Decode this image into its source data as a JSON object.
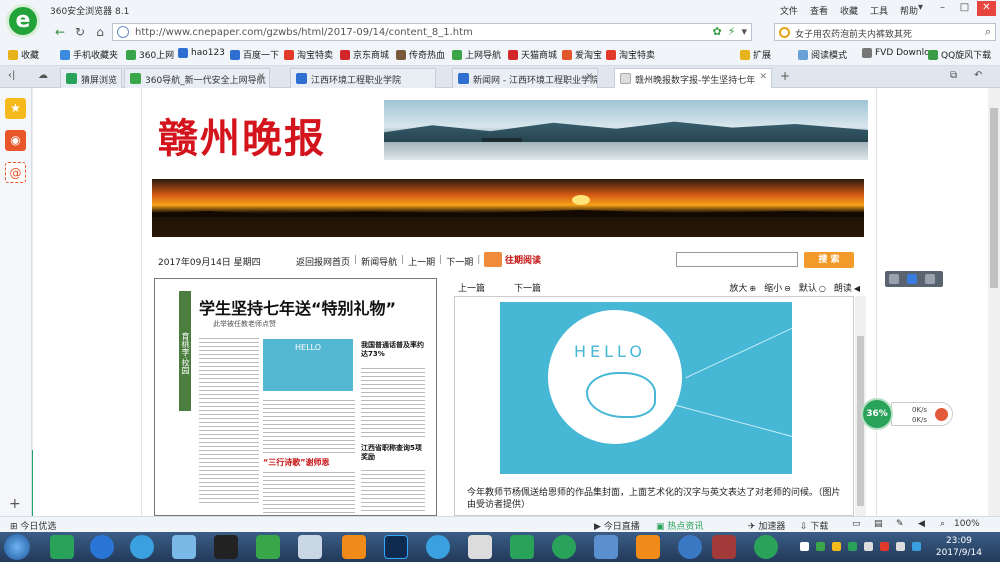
{
  "browser": {
    "title": "360安全浏览器 8.1",
    "menu": [
      "文件",
      "查看",
      "收藏",
      "工具",
      "帮助"
    ],
    "url": "http://www.cnepaper.com/gzwbs/html/2017-09/14/content_8_1.htm",
    "search_text": "女子用农药泡前夫内裤致其死",
    "logo_letter": "e"
  },
  "favorites": [
    {
      "label": "收藏",
      "color": "#e8b21a"
    },
    {
      "label": "手机收藏夹",
      "color": "#3a8be0"
    },
    {
      "label": "360上网",
      "color": "#3aa64a"
    },
    {
      "label": "hao123",
      "color": "#2f6fd1"
    },
    {
      "label": "百度一下",
      "color": "#2f6fd1"
    },
    {
      "label": "淘宝特卖",
      "color": "#e23a2a"
    },
    {
      "label": "京东商城",
      "color": "#d3262a"
    },
    {
      "label": "传奇热血",
      "color": "#7a5a3a"
    },
    {
      "label": "上网导航",
      "color": "#3aa64a"
    },
    {
      "label": "天猫商城",
      "color": "#d3262a"
    },
    {
      "label": "爱淘宝",
      "color": "#e2562a"
    },
    {
      "label": "淘宝特卖",
      "color": "#e23a2a"
    },
    {
      "label": "扩展",
      "color": "#e8b21a"
    },
    {
      "label": "阅读模式",
      "color": "#6aa0d8"
    },
    {
      "label": "FVD Downloa",
      "color": "#777777"
    },
    {
      "label": "QQ旋风下载",
      "color": "#3a9b46"
    }
  ],
  "tabs": [
    {
      "label": "猜屏浏览",
      "color": "#2aa35a"
    },
    {
      "label": "360导航_新一代安全上网导航",
      "color": "#3aa64a"
    },
    {
      "label": "江西环境工程职业学院",
      "color": "#2f6fd1"
    },
    {
      "label": "新闻网 - 江西环境工程职业学院",
      "color": "#2f6fd1"
    },
    {
      "label": "赣州晚报数字报-学生坚持七年",
      "color": "#dddddd"
    }
  ],
  "page": {
    "masthead": "赣州晚报",
    "date": "2017年09月14日  星期四",
    "nav_links": [
      "返回报网首页",
      "新闻导航",
      "上一期",
      "下一期"
    ],
    "past_issue": "往期阅读",
    "search_button": "搜 索"
  },
  "newspaper": {
    "headline": "学生坚持七年送“特别礼物”",
    "subhead": "此举被任教老师点赞",
    "column": "育桃李·校园",
    "hello": "HELLO",
    "side_story1": "我国普通话普及率约达73%",
    "poem": "“三行诗歌”谢师恩",
    "side_story2": "江西省职称查询5项奖励"
  },
  "article": {
    "prev": "上一篇",
    "next": "下一篇",
    "tools": [
      "放大",
      "缩小",
      "默认",
      "朗读"
    ],
    "cover_hello": "HELLO",
    "caption": "今年教师节杨佩送给恩师的作品集封面，上面艺术化的汉字与英文表达了对老师的问候。（图片由受访者提供）"
  },
  "widgets": {
    "speed_percent": "36%",
    "upload": "0K/s",
    "download": "0K/s"
  },
  "statusbar": {
    "left": "今日优选",
    "items": [
      "今日直播",
      "热点资讯",
      "加速器",
      "下载"
    ],
    "zoom": "100%"
  },
  "taskbar": {
    "time": "23:09",
    "date": "2017/9/14"
  }
}
